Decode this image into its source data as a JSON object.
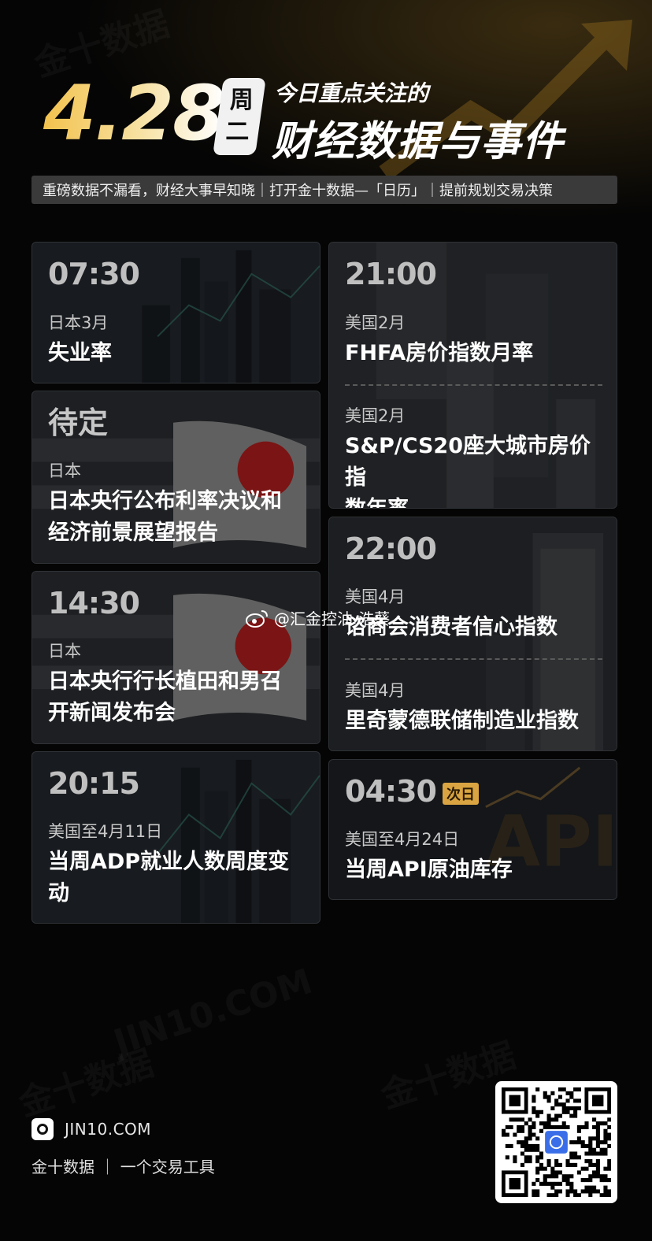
{
  "header": {
    "date": "4.28",
    "weekday_line1": "周",
    "weekday_line2": "二",
    "headline_small": "今日重点关注的",
    "headline_big": "财经数据与事件"
  },
  "subtitle": "重磅数据不漏看，财经大事早知晓｜打开金十数据—「日历」｜提前规划交易决策",
  "watermark_text": "@汇金控油-浩葵",
  "colors": {
    "gold": "#f3c24d",
    "badge": "#d9a441",
    "background": "#050505"
  },
  "left_cards": [
    {
      "time": "07:30",
      "events": [
        {
          "region": "日本3月",
          "title": "失业率"
        }
      ]
    },
    {
      "time": "待定",
      "events": [
        {
          "region": "日本",
          "title_lines": [
            "日本央行公布利率决议和",
            "经济前景展望报告"
          ]
        }
      ]
    },
    {
      "time": "14:30",
      "events": [
        {
          "region": "日本",
          "title_lines": [
            "日本央行行长植田和男召",
            "开新闻发布会"
          ]
        }
      ]
    },
    {
      "time": "20:15",
      "events": [
        {
          "region": "美国至4月11日",
          "title_lines": [
            "当周ADP就业人数周度变",
            "动"
          ]
        }
      ]
    }
  ],
  "right_cards": [
    {
      "time": "21:00",
      "events": [
        {
          "region": "美国2月",
          "title": "FHFA房价指数月率"
        },
        {
          "region": "美国2月",
          "title_lines": [
            "S&P/CS20座大城市房价指",
            "数年率"
          ]
        }
      ]
    },
    {
      "time": "22:00",
      "events": [
        {
          "region": "美国4月",
          "title": "谘商会消费者信心指数"
        },
        {
          "region": "美国4月",
          "title": "里奇蒙德联储制造业指数"
        }
      ]
    },
    {
      "time": "04:30",
      "badge": "次日",
      "events": [
        {
          "region": "美国至4月24日",
          "title": "当周API原油库存"
        }
      ]
    }
  ],
  "footer": {
    "brand_url": "JIN10.COM",
    "tagline": "金十数据 ｜ 一个交易工具",
    "logo_icon": "jin10-logo-icon",
    "qr_icon": "qr-code-icon"
  }
}
